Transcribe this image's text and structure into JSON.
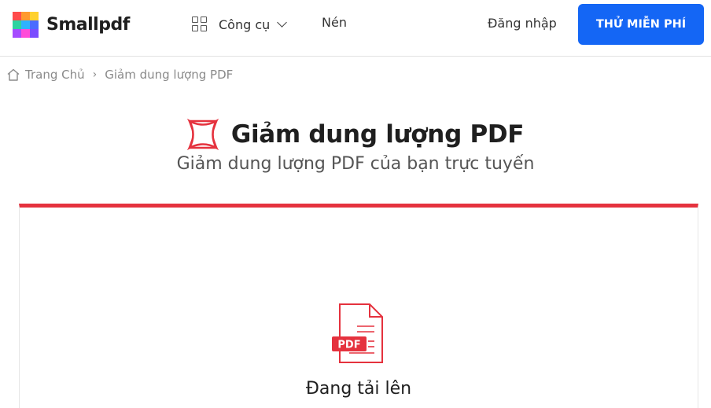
{
  "header": {
    "logo_text": "Smallpdf",
    "logo_colors": [
      "#ff4c4c",
      "#ff9a2e",
      "#ffd12e",
      "#2ed3a0",
      "#2eb2ff",
      "#4a6cff",
      "#a64cff",
      "#ff4cd8",
      "#7a4cff"
    ],
    "nav": {
      "tools_label": "Công cụ",
      "tools_icon": "grid-icon",
      "tools_chevron": "chevron-down-icon",
      "compress_label": "Nén"
    },
    "login_label": "Đăng nhập",
    "cta_label": "THỬ MIỄN PHÍ",
    "cta_color": "#1466f5"
  },
  "breadcrumb": {
    "home_icon": "home-icon",
    "home_label": "Trang Chủ",
    "separator": "›",
    "current_label": "Giảm dung lượng PDF"
  },
  "page": {
    "title_icon": "compress-icon",
    "title": "Giảm dung lượng PDF",
    "subtitle": "Giảm dung lượng PDF của bạn trực tuyến",
    "accent_color": "#e5323e"
  },
  "upload": {
    "file_icon": "pdf-file-icon",
    "file_badge": "PDF",
    "status": "Đang tải lên"
  }
}
